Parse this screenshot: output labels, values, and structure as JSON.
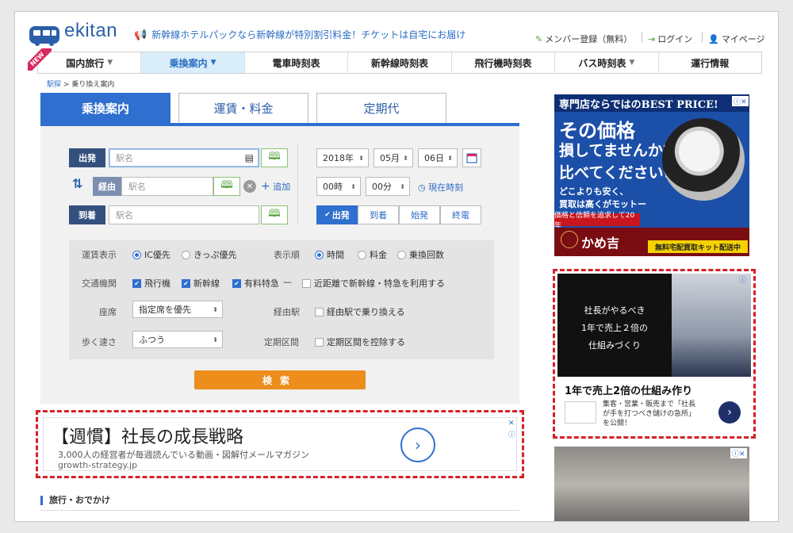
{
  "header": {
    "logo_text": "ekitan",
    "promo": "新幹線ホテルパックなら新幹線が特別割引料金！チケットは自宅にお届け",
    "links": [
      {
        "label": "メンバー登録（無料）"
      },
      {
        "label": "ログイン"
      },
      {
        "label": "マイページ"
      }
    ]
  },
  "nav": {
    "new_badge": "NEW",
    "items": [
      {
        "label": "国内旅行",
        "arrow": "▼"
      },
      {
        "label": "乗換案内",
        "arrow": "▼"
      },
      {
        "label": "電車時刻表",
        "arrow": ""
      },
      {
        "label": "新幹線時刻表",
        "arrow": ""
      },
      {
        "label": "飛行機時刻表",
        "arrow": ""
      },
      {
        "label": "バス時刻表",
        "arrow": "▼"
      },
      {
        "label": "運行情報",
        "arrow": ""
      }
    ]
  },
  "breadcrumb": {
    "home": "駅探",
    "sep": ">",
    "current": "乗り換え案内"
  },
  "tabs": [
    {
      "label": "乗換案内"
    },
    {
      "label": "運賃・料金"
    },
    {
      "label": "定期代"
    }
  ],
  "form": {
    "departure_label": "出発",
    "via_label": "経由",
    "arrival_label": "到着",
    "placeholder": "駅名",
    "add_label": "追加",
    "year": "2018年",
    "month": "05月",
    "day": "06日",
    "hour": "00時",
    "minute": "00分",
    "now_label": "現在時刻",
    "time_modes": [
      "出発",
      "到着",
      "始発",
      "終電"
    ],
    "fare_label": "運賃表示",
    "fare_opts": [
      "IC優先",
      "きっぷ優先"
    ],
    "order_label": "表示順",
    "order_opts": [
      "時間",
      "料金",
      "乗換回数"
    ],
    "transport_label": "交通機関",
    "transport_opts": [
      "飛行機",
      "新幹線",
      "有料特急"
    ],
    "dash": "—",
    "short_dist": "近距離で新幹線・特急を利用する",
    "seat_label": "座席",
    "seat_value": "指定席を優先",
    "via_station_label": "経由駅",
    "via_transfer": "経由駅で乗り換える",
    "walk_label": "歩く速さ",
    "walk_value": "ふつう",
    "commuter_label": "定期区間",
    "commuter_opt": "定期区間を控除する",
    "search_label": "検索"
  },
  "ad_bottom": {
    "title": "【週慣】社長の成長戦略",
    "subtitle": "3,000人の経営者が毎週読んでいる動画・図解付メールマガジン",
    "url": "growth-strategy.jp"
  },
  "section_travel": "旅行・おでかけ",
  "ad_watch": {
    "top": "専門店ならではのBEST PRICE!",
    "line1": "その価格",
    "line2": "損してませんか?",
    "line3": "比べてください!",
    "line4": "どこよりも安く、",
    "line5": "買取は高くがモットー",
    "red": "価格と信頼を追求して20年",
    "brand": "かめ吉",
    "yellow": "無料宅配買取キット配送中"
  },
  "ad_ceo": {
    "dark_line1": "社長がやるべき",
    "dark_line2": "1年で売上２倍の",
    "dark_line3": "仕組みづくり",
    "title": "1年で売上2倍の仕組み作り",
    "desc1": "集客・営業・販売まで「社長",
    "desc2": "が手を打つべき儲けの急所」",
    "desc3": "を公開！"
  },
  "colors": {
    "accent": "#2f6fcf",
    "search": "#ec8d1c",
    "highlight": "#d6202a"
  }
}
